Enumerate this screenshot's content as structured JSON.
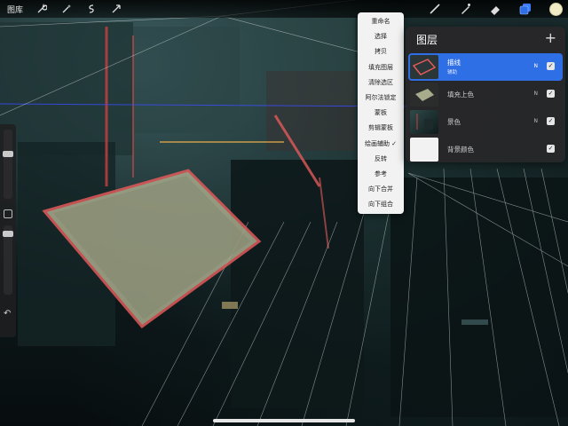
{
  "toolbar": {
    "gallery_label": "图库",
    "left_tools": [
      "wrench-icon",
      "magic-wand-icon",
      "selection-icon",
      "transform-icon"
    ],
    "right_tools": [
      "brush-icon",
      "smudge-icon",
      "eraser-icon",
      "layers-icon"
    ],
    "current_color": "#f1ebc6"
  },
  "layer_menu": {
    "items": [
      "重命名",
      "选择",
      "拷贝",
      "填充图层",
      "清除选区",
      "阿尔法锁定",
      "蒙板",
      "剪辑蒙板",
      "绘画辅助 ✓",
      "反转",
      "参考",
      "向下合并",
      "向下组合"
    ]
  },
  "layers_panel": {
    "title": "图层",
    "add_label": "+",
    "layers": [
      {
        "name": "描线",
        "sub": "辅助",
        "blend": "N",
        "visible": true,
        "active": true
      },
      {
        "name": "填充上色",
        "sub": "",
        "blend": "N",
        "visible": true,
        "active": false
      },
      {
        "name": "景色",
        "sub": "",
        "blend": "N",
        "visible": true,
        "active": false
      },
      {
        "name": "背景颜色",
        "sub": "",
        "blend": "",
        "visible": true,
        "active": false
      }
    ]
  },
  "colors": {
    "accent_blue": "#2f6fe6",
    "selection_red": "#e35a5a",
    "guide_line": "#ffffff"
  }
}
